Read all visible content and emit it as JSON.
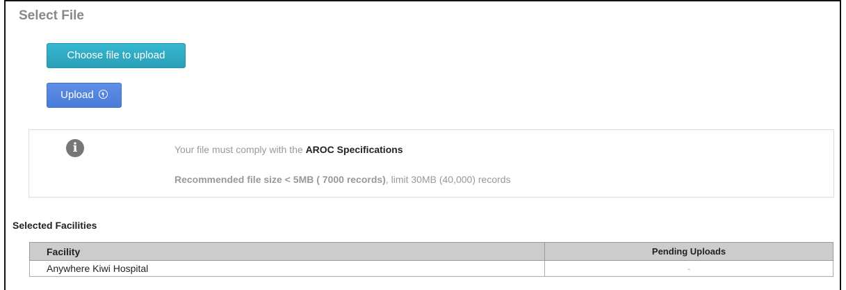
{
  "section_title": "Select File",
  "choose_button": "Choose file to upload",
  "upload_button": "Upload",
  "info": {
    "icon": "info-icon",
    "line1_prefix": "Your file must comply with the ",
    "line1_link": "AROC Specifications",
    "line2_bold": "Recommended file size < 5MB ( 7000 records)",
    "line2_rest": ", limit 30MB (40,000) records"
  },
  "selected_facilities_title": "Selected Facilities",
  "table": {
    "headers": [
      "Facility",
      "Pending Uploads"
    ],
    "rows": [
      {
        "facility": "Anywhere Kiwi Hospital",
        "pending": "-"
      }
    ]
  },
  "colors": {
    "choose_button": "#2fa9c2",
    "upload_button": "#5585df",
    "header_bg": "#cccccc"
  }
}
